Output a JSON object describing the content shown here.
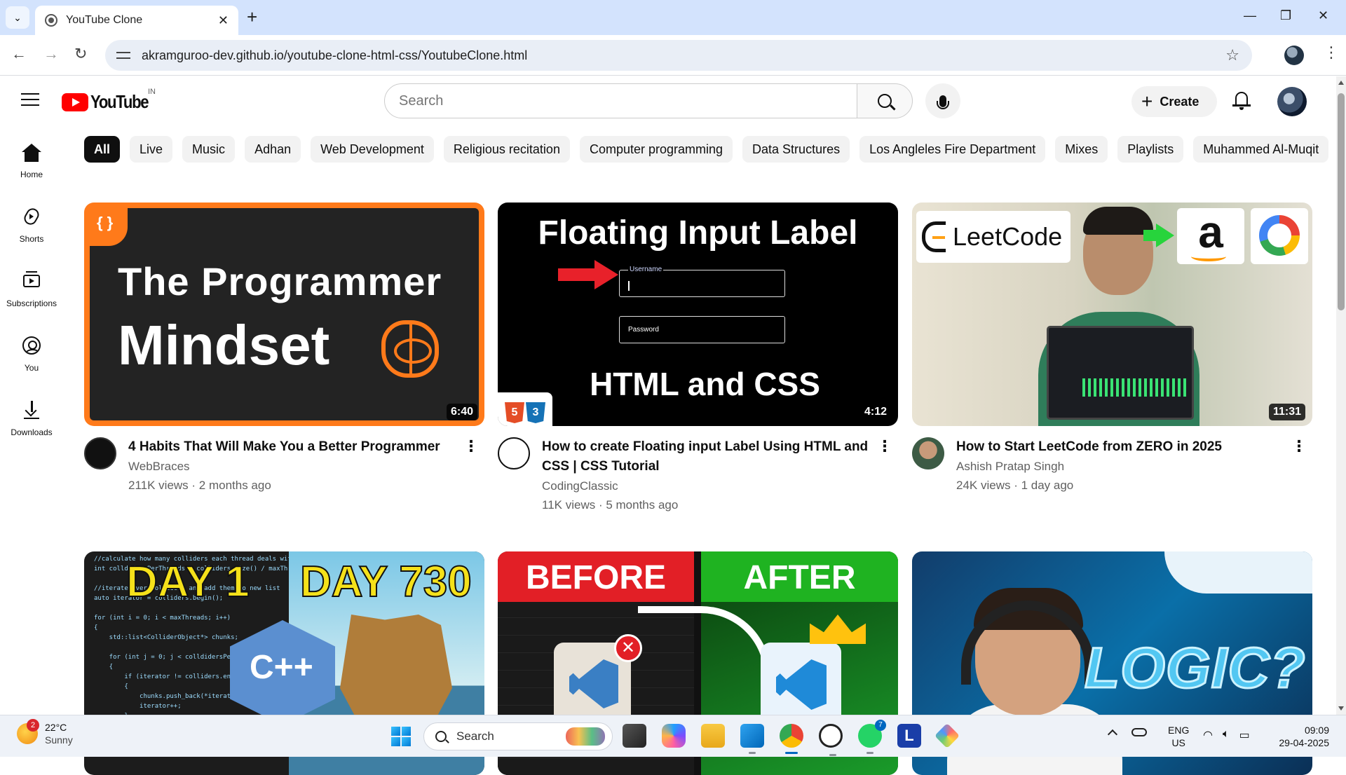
{
  "browser": {
    "tab_title": "YouTube Clone",
    "url": "akramguroo-dev.github.io/youtube-clone-html-css/YoutubeClone.html",
    "new_tab_label": "+",
    "tab_close": "✕"
  },
  "youtube": {
    "logo_text": "YouTube",
    "country_code": "IN",
    "search_placeholder": "Search",
    "create_label": "Create"
  },
  "sidebar": {
    "items": [
      {
        "label": "Home"
      },
      {
        "label": "Shorts"
      },
      {
        "label": "Subscriptions"
      },
      {
        "label": "You"
      },
      {
        "label": "Downloads"
      }
    ]
  },
  "chips": [
    "All",
    "Live",
    "Music",
    "Adhan",
    "Web Development",
    "Religious recitation",
    "Computer programming",
    "Data Structures",
    "Los Angleles Fire Department",
    "Mixes",
    "Playlists",
    "Muhammed Al-Muqit"
  ],
  "videos": [
    {
      "title": "4 Habits That Will Make You a Better Programmer",
      "channel": "WebBraces",
      "stats": "211K views · 2 months ago",
      "duration": "6:40",
      "thumb_line1": "The Programmer",
      "thumb_line2": "Mindset",
      "thumb_badge": "{ }"
    },
    {
      "title": "How to create Floating input Label Using HTML and CSS | CSS Tutorial",
      "channel": "CodingClassic",
      "stats": "11K views · 5 months ago",
      "duration": "4:12",
      "thumb_title": "Floating Input Label",
      "thumb_field1": "Username",
      "thumb_field2": "Password",
      "thumb_bottom": "HTML and CSS",
      "thumb_html_badge": "5",
      "thumb_css_badge": "3"
    },
    {
      "title": "How to Start LeetCode from ZERO in 2025",
      "channel": "Ashish Pratap Singh",
      "stats": "24K views · 1 day ago",
      "duration": "11:31",
      "thumb_brand": "LeetCode",
      "thumb_amazon": "a"
    },
    {
      "thumb_day1": "DAY 1",
      "thumb_day2": "DAY 730",
      "thumb_code": "//calculate how many colliders each thread deals with\nint colldidersPerThreads = colliders.size() / maxThre\n\n//iterate over colliders and add them to new list\nauto iterator = colliders.begin();\n\nfor (int i = 0; i < maxThreads; i++)\n{\n    std::list<ColliderObject*> chunks;\n\n    for (int j = 0; j < colldidersPerThr\n    {\n        if (iterator != colliders.end(\n        {\n            chunks.push_back(*iterator\n            iterator++;\n        }\n    }\n    //since my threads are in a list pu\n    threads.push_back(std::thread(updateCol"
    },
    {
      "thumb_before": "BEFORE",
      "thumb_after": "AFTER"
    },
    {
      "thumb_text": "LOGIC?"
    }
  ],
  "taskbar": {
    "weather_temp": "22°C",
    "weather_desc": "Sunny",
    "weather_badge": "2",
    "search_placeholder": "Search",
    "whatsapp_badge": "7",
    "lang_line1": "ENG",
    "lang_line2": "US",
    "time": "09:09",
    "date": "29-04-2025"
  },
  "colors": {
    "youtube_red": "#ff0000",
    "chip_active": "#0f0f0f",
    "chip_bg": "#f2f2f2",
    "browser_tabstrip": "#d3e3fd"
  }
}
